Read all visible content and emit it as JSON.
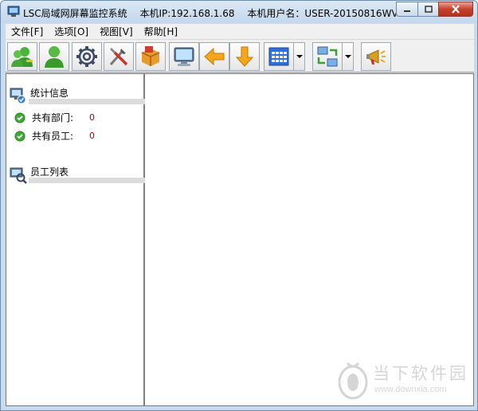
{
  "window": {
    "app_title": "LSC局域网屏幕监控系统",
    "ip_text": "本机IP:192.168.1.68",
    "user_text": "本机用户名：USER-20150816WV"
  },
  "menu": {
    "items": [
      {
        "label": "文件[F]"
      },
      {
        "label": "选项[O]"
      },
      {
        "label": "视图[V]"
      },
      {
        "label": "帮助[H]"
      }
    ]
  },
  "toolbar": {
    "buttons": [
      {
        "icon": "add-user-icon"
      },
      {
        "icon": "user-icon"
      },
      {
        "icon": "gear-icon"
      },
      {
        "icon": "tools-icon"
      },
      {
        "icon": "package-icon"
      },
      {
        "icon": "monitor-icon"
      },
      {
        "icon": "arrow-left-icon"
      },
      {
        "icon": "arrow-down-icon"
      },
      {
        "icon": "grid-icon"
      },
      {
        "icon": "network-transfer-icon"
      },
      {
        "icon": "megaphone-icon"
      }
    ]
  },
  "left_panel": {
    "stats_section": {
      "title": "统计信息",
      "rows": [
        {
          "label": "共有部门:",
          "value": "0"
        },
        {
          "label": "共有员工:",
          "value": "0"
        }
      ]
    },
    "employee_section": {
      "title": "员工列表"
    }
  },
  "watermark": {
    "text": "当下软件园",
    "url": "www.downxia.com"
  },
  "colors": {
    "accent_green": "#3faa35",
    "value_red": "#b00000",
    "frame_blue": "#c9dcef"
  }
}
